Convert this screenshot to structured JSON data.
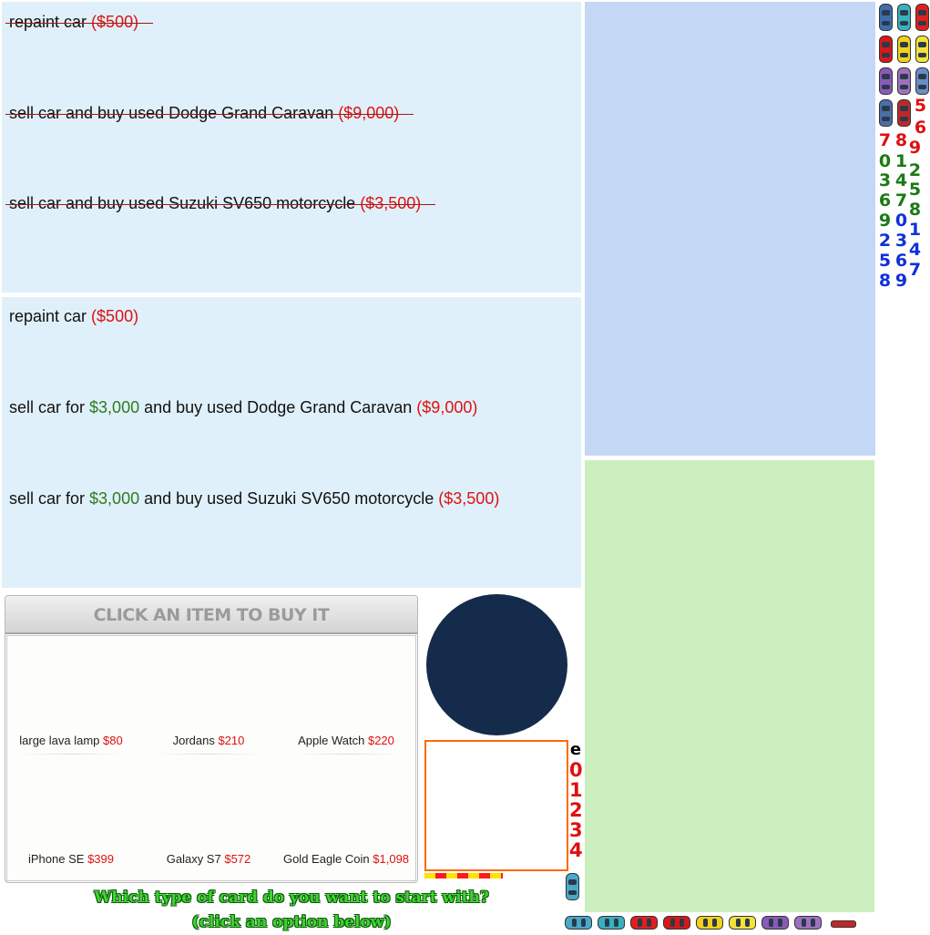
{
  "panel_top": {
    "options": [
      {
        "text": "repaint car ",
        "price": "($500)"
      },
      {
        "text": "sell car and buy used Dodge Grand Caravan ",
        "price": "($9,000)"
      },
      {
        "text": "sell car and buy used Suzuki SV650 motorcycle ",
        "price": "($3,500)"
      }
    ]
  },
  "panel_mid": {
    "options": [
      {
        "pre": "repaint car ",
        "gain": "",
        "post": "",
        "price": "($500)"
      },
      {
        "pre": "sell car for ",
        "gain": "$3,000",
        "post": " and buy used Dodge Grand Caravan ",
        "price": "($9,000)"
      },
      {
        "pre": "sell car for ",
        "gain": "$3,000",
        "post": " and buy used Suzuki SV650 motorcycle ",
        "price": "($3,500)"
      }
    ]
  },
  "shop": {
    "header": "CLICK AN ITEM TO BUY IT",
    "items": [
      {
        "name": "large lava lamp",
        "price": "$80"
      },
      {
        "name": "Jordans",
        "price": "$210"
      },
      {
        "name": "Apple Watch",
        "price": "$220"
      },
      {
        "name": "iPhone SE",
        "price": "$399"
      },
      {
        "name": "Galaxy S7",
        "price": "$572"
      },
      {
        "name": "Gold Eagle Coin",
        "price": "$1,098"
      }
    ]
  },
  "digit_column": [
    "e",
    "0",
    "1",
    "2",
    "3",
    "4"
  ],
  "prompt": {
    "line1": "Which type of card do you want to start with?",
    "line2": "(click an option below)"
  },
  "sprite_sheet": {
    "car_colors": [
      "#3d6fae",
      "#3ab0c0",
      "#e02020",
      "#d81818",
      "#f2d21a",
      "#f4e23a",
      "#8a5ab8",
      "#a070c0",
      "#6a8cc8",
      "#4a6fa8",
      "#c02828"
    ],
    "digits": [
      {
        "d": "5",
        "color": "#e01010"
      },
      {
        "d": "6",
        "color": "#e01010"
      },
      {
        "d": "7",
        "color": "#e01010"
      },
      {
        "d": "8",
        "color": "#e01010"
      },
      {
        "d": "9",
        "color": "#e01010"
      },
      {
        "d": "0",
        "color": "#1a7a12"
      },
      {
        "d": "1",
        "color": "#1a7a12"
      },
      {
        "d": "2",
        "color": "#1a7a12"
      },
      {
        "d": "3",
        "color": "#1a7a12"
      },
      {
        "d": "4",
        "color": "#1a7a12"
      },
      {
        "d": "5",
        "color": "#1a7a12"
      },
      {
        "d": "6",
        "color": "#1a7a12"
      },
      {
        "d": "7",
        "color": "#1a7a12"
      },
      {
        "d": "8",
        "color": "#1a7a12"
      },
      {
        "d": "9",
        "color": "#1a7a12"
      },
      {
        "d": "0",
        "color": "#1030d8"
      },
      {
        "d": "1",
        "color": "#1030d8"
      },
      {
        "d": "2",
        "color": "#1030d8"
      },
      {
        "d": "3",
        "color": "#1030d8"
      },
      {
        "d": "4",
        "color": "#1030d8"
      },
      {
        "d": "5",
        "color": "#1030d8"
      },
      {
        "d": "6",
        "color": "#1030d8"
      },
      {
        "d": "7",
        "color": "#1030d8"
      },
      {
        "d": "8",
        "color": "#1030d8"
      },
      {
        "d": "9",
        "color": "#1030d8"
      }
    ]
  }
}
